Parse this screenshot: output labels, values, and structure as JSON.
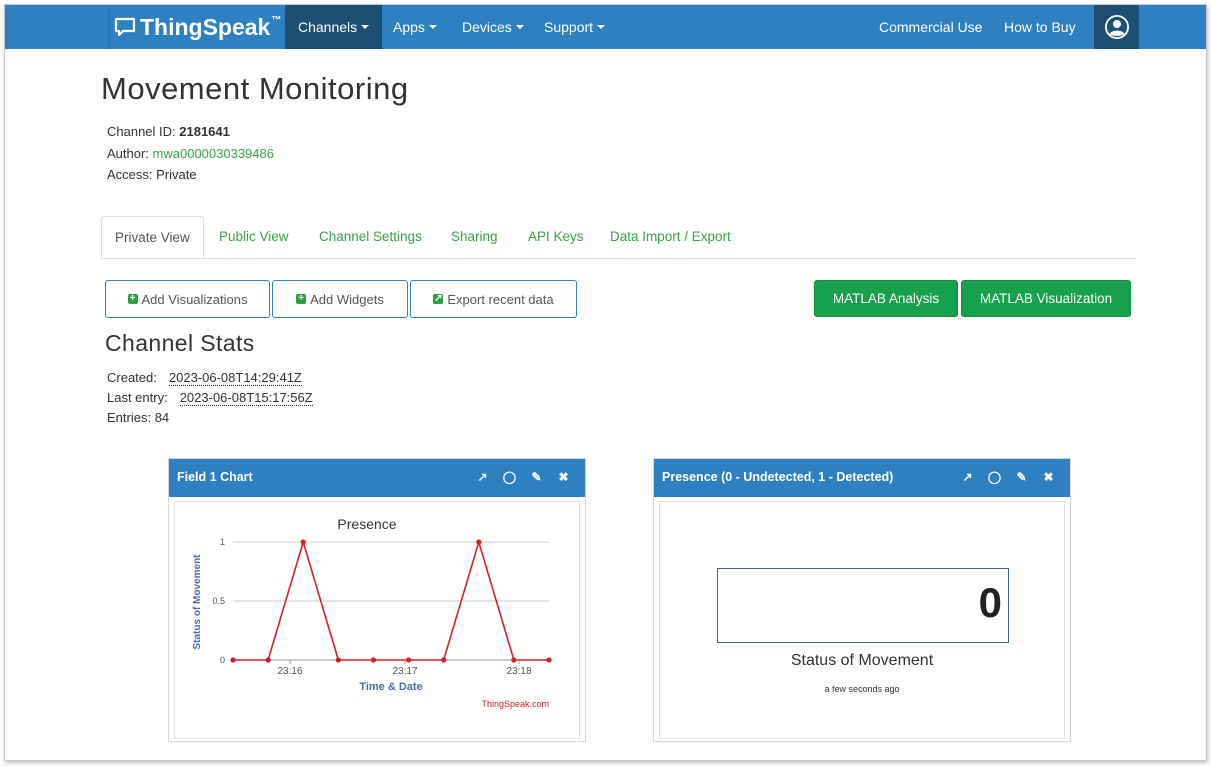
{
  "navbar": {
    "brand": "ThingSpeak",
    "trademark": "™",
    "items": [
      {
        "label": "Channels"
      },
      {
        "label": "Apps"
      },
      {
        "label": "Devices"
      },
      {
        "label": "Support"
      }
    ],
    "right_items": [
      {
        "label": "Commercial Use"
      },
      {
        "label": "How to Buy"
      }
    ]
  },
  "channel": {
    "title": "Movement Monitoring",
    "id_label": "Channel ID: ",
    "id_value": "2181641",
    "author_label": "Author: ",
    "author_value": "mwa0000030339486",
    "access_label": "Access: ",
    "access_value": "Private"
  },
  "tabs": [
    "Private View",
    "Public View",
    "Channel Settings",
    "Sharing",
    "API Keys",
    "Data Import / Export"
  ],
  "buttons": {
    "add_visualizations": "Add Visualizations",
    "add_widgets": "Add Widgets",
    "export_recent": "Export recent data",
    "matlab_analysis": "MATLAB Analysis",
    "matlab_visualization": "MATLAB Visualization"
  },
  "stats": {
    "heading": "Channel Stats",
    "created_label": "Created:",
    "created_value": "2023-06-08T14:29:41Z",
    "last_entry_label": "Last entry:",
    "last_entry_value": "2023-06-08T15:17:56Z",
    "entries_label": "Entries: ",
    "entries_value": "84"
  },
  "panels": {
    "chart_title": "Field 1 Chart",
    "gauge_title": "Presence (0 - Undetected, 1 - Detected)",
    "gauge_value": "0",
    "gauge_label": "Status of Movement",
    "gauge_time": "a few seconds ago"
  },
  "colors": {
    "navbar": "#2f80c0",
    "nav_active": "#1d4f75",
    "link_green": "#3aa14a",
    "matlab_green": "#18a14c",
    "series": "#d0202a"
  },
  "chart_data": {
    "type": "line",
    "title": "Presence",
    "xlabel": "Time & Date",
    "ylabel": "Status of Movement",
    "credit": "ThingSpeak.com",
    "x_ticks": [
      "23:16",
      "23:17",
      "23:18"
    ],
    "y_ticks": [
      "0",
      "0.5",
      "1"
    ],
    "ylim": [
      0,
      1
    ],
    "grid": true,
    "series": [
      {
        "values": [
          0,
          0,
          1,
          0,
          0,
          0,
          0,
          1,
          0,
          0
        ]
      }
    ]
  }
}
